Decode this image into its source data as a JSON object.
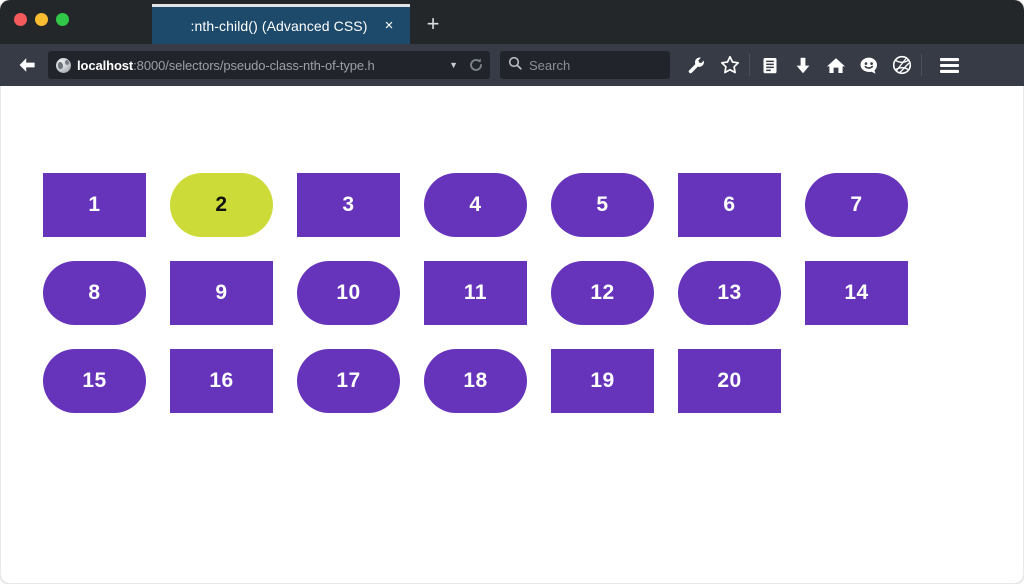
{
  "window": {
    "controls": [
      {
        "name": "close",
        "color": "#f4595b"
      },
      {
        "name": "minimize",
        "color": "#f9bb2f"
      },
      {
        "name": "maximize",
        "color": "#31c748"
      }
    ]
  },
  "tabbar": {
    "tab_title": ":nth-child() (Advanced CSS)",
    "close_label": "×",
    "new_tab_label": "+"
  },
  "navbar": {
    "back_icon": "back-arrow-icon",
    "url": {
      "host": "localhost",
      "path": ":8000/selectors/pseudo-class-nth-of-type.h",
      "dropdown_label": "▼",
      "reload_icon": "reload-icon",
      "favicon": "globe-favicon-icon"
    },
    "search": {
      "placeholder": "Search",
      "icon": "search-icon"
    },
    "icons": [
      {
        "name": "wrench-icon",
        "label": "Developer Tools"
      },
      {
        "name": "star-icon",
        "label": "Bookmark"
      },
      {
        "name": "reading-list-icon",
        "label": "Reading List"
      },
      {
        "name": "download-icon",
        "label": "Downloads"
      },
      {
        "name": "home-icon",
        "label": "Home"
      },
      {
        "name": "smiley-icon",
        "label": "Feedback"
      },
      {
        "name": "pocket-icon",
        "label": "Save to Pocket"
      },
      {
        "name": "hamburger-menu-icon",
        "label": "Open Menu"
      }
    ]
  },
  "page": {
    "boxes": [
      {
        "label": "1",
        "shape": "rect",
        "highlight": false
      },
      {
        "label": "2",
        "shape": "pill",
        "highlight": true
      },
      {
        "label": "3",
        "shape": "rect",
        "highlight": false
      },
      {
        "label": "4",
        "shape": "pill",
        "highlight": false
      },
      {
        "label": "5",
        "shape": "pill",
        "highlight": false
      },
      {
        "label": "6",
        "shape": "rect",
        "highlight": false
      },
      {
        "label": "7",
        "shape": "pill",
        "highlight": false
      },
      {
        "label": "8",
        "shape": "pill",
        "highlight": false
      },
      {
        "label": "9",
        "shape": "rect",
        "highlight": false
      },
      {
        "label": "10",
        "shape": "pill",
        "highlight": false
      },
      {
        "label": "11",
        "shape": "rect",
        "highlight": false
      },
      {
        "label": "12",
        "shape": "pill",
        "highlight": false
      },
      {
        "label": "13",
        "shape": "pill",
        "highlight": false
      },
      {
        "label": "14",
        "shape": "rect",
        "highlight": false
      },
      {
        "label": "15",
        "shape": "pill",
        "highlight": false
      },
      {
        "label": "16",
        "shape": "rect",
        "highlight": false
      },
      {
        "label": "17",
        "shape": "pill",
        "highlight": false
      },
      {
        "label": "18",
        "shape": "pill",
        "highlight": false
      },
      {
        "label": "19",
        "shape": "rect",
        "highlight": false
      },
      {
        "label": "20",
        "shape": "rect",
        "highlight": false
      }
    ],
    "colors": {
      "box_default": "#6633bb",
      "box_highlight": "#ccdb38",
      "box_default_text": "#ffffff",
      "box_highlight_text": "#111111",
      "page_background": "#ffffff"
    }
  }
}
